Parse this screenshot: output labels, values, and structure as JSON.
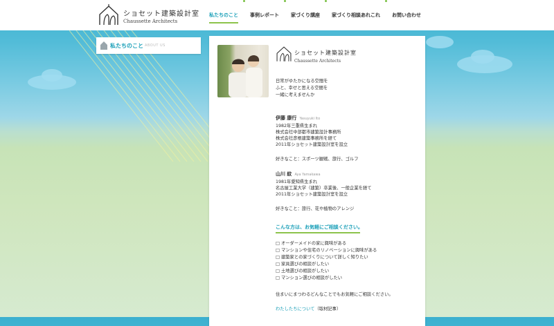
{
  "brand": {
    "name_jp": "ショセット建築設計室",
    "name_en": "Chaussette Architects"
  },
  "nav": {
    "items": [
      {
        "label": "私たちのこと",
        "active": true
      },
      {
        "label": "事例レポート",
        "active": false
      },
      {
        "label": "家づくり講座",
        "active": false
      },
      {
        "label": "家づくり相談あれこれ",
        "active": false
      },
      {
        "label": "お問い合わせ",
        "active": false
      }
    ]
  },
  "sidebar": {
    "title_jp": "私たちのこと",
    "title_en": "ABOUT US"
  },
  "card": {
    "logo_jp": "ショセット建築設計室",
    "logo_en": "Chaussette Architects",
    "tagline": [
      "日常がゆたかになる空間を",
      "ふと、幸せと思える空間を",
      "一緒に考えませんか"
    ],
    "people": [
      {
        "name": "伊藤 康行",
        "roman": "Yasuyuki Ito",
        "bio": [
          "1982年三重県生まれ",
          "株式会社中部都市建築設計事務所",
          "株式会社彦根建築事務所を経て",
          "2011年ショセット建築設計室を設立"
        ],
        "likes": "好きなこと：スポーツ観戦、旅行、ゴルフ"
      },
      {
        "name": "山川 紋",
        "roman": "Aya Yamakawa",
        "bio": [
          "1981年愛知県生まれ",
          "名古屋工業大学（建築）卒業後、一般企業を経て",
          "2011年ショセット建築設計室を設立"
        ],
        "likes": "好きなこと：旅行、花や植物のアレンジ"
      }
    ],
    "consult_heading": "こんな方は、お気軽にご相談ください。",
    "checklist": [
      "□ オーダーメイドの家に興味がある",
      "□ マンションや住宅のリノベーションに興味がある",
      "□ 建築家との家づくりについて詳しく知りたい",
      "□ 家具選びの相談がしたい",
      "□ 土地選びの相談がしたい",
      "□ マンション選びの相談がしたい"
    ],
    "closing": "住まいにまつわるどんなことでもお気軽にご相談ください。",
    "article_link": "わたしたちについて",
    "article_suffix": "（取材記事）"
  },
  "colors": {
    "accent": "#1a9fb8",
    "green": "#8cc34a",
    "sky": "#3bb0cf",
    "grass": "#cfe6bd"
  },
  "icons": {
    "logo": "house-sock-icon",
    "sidebar": "house-icon",
    "nav_separator": "dot-icon"
  }
}
